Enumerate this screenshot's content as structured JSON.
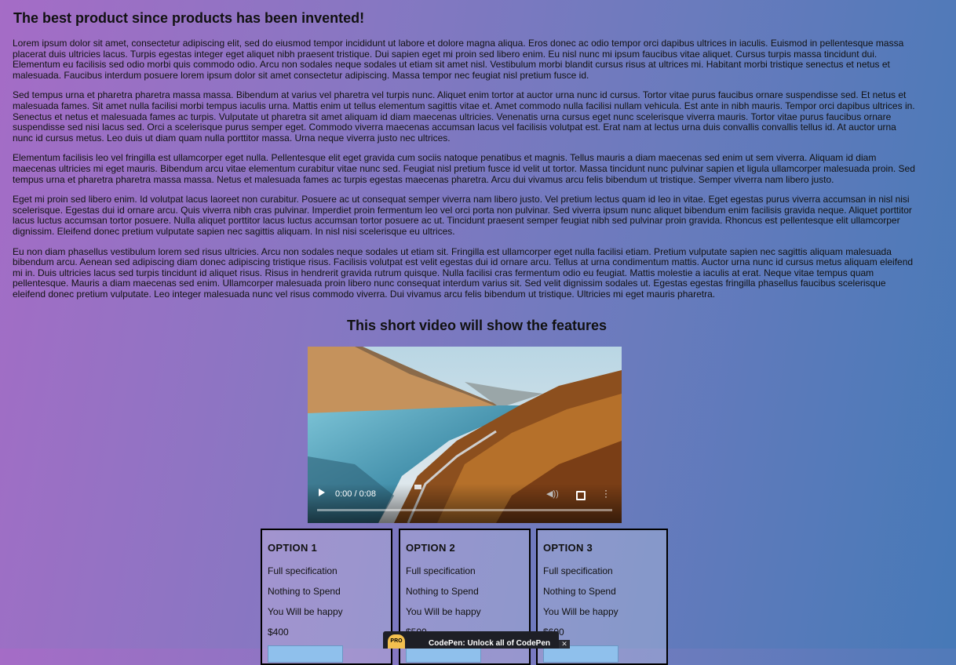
{
  "page": {
    "title": "The best product since products has been invented!",
    "paragraphs": [
      "Lorem ipsum dolor sit amet, consectetur adipiscing elit, sed do eiusmod tempor incididunt ut labore et dolore magna aliqua. Eros donec ac odio tempor orci dapibus ultrices in iaculis. Euismod in pellentesque massa placerat duis ultricies lacus. Turpis egestas integer eget aliquet nibh praesent tristique. Dui sapien eget mi proin sed libero enim. Eu nisl nunc mi ipsum faucibus vitae aliquet. Cursus turpis massa tincidunt dui. Elementum eu facilisis sed odio morbi quis commodo odio. Arcu non sodales neque sodales ut etiam sit amet nisl. Vestibulum morbi blandit cursus risus at ultrices mi. Habitant morbi tristique senectus et netus et malesuada. Faucibus interdum posuere lorem ipsum dolor sit amet consectetur adipiscing. Massa tempor nec feugiat nisl pretium fusce id.",
      "Sed tempus urna et pharetra pharetra massa massa. Bibendum at varius vel pharetra vel turpis nunc. Aliquet enim tortor at auctor urna nunc id cursus. Tortor vitae purus faucibus ornare suspendisse sed. Et netus et malesuada fames. Sit amet nulla facilisi morbi tempus iaculis urna. Mattis enim ut tellus elementum sagittis vitae et. Amet commodo nulla facilisi nullam vehicula. Est ante in nibh mauris. Tempor orci dapibus ultrices in. Senectus et netus et malesuada fames ac turpis. Vulputate ut pharetra sit amet aliquam id diam maecenas ultricies. Venenatis urna cursus eget nunc scelerisque viverra mauris. Tortor vitae purus faucibus ornare suspendisse sed nisi lacus sed. Orci a scelerisque purus semper eget. Commodo viverra maecenas accumsan lacus vel facilisis volutpat est. Erat nam at lectus urna duis convallis convallis tellus id. At auctor urna nunc id cursus metus. Leo duis ut diam quam nulla porttitor massa. Urna neque viverra justo nec ultrices.",
      "Elementum facilisis leo vel fringilla est ullamcorper eget nulla. Pellentesque elit eget gravida cum sociis natoque penatibus et magnis. Tellus mauris a diam maecenas sed enim ut sem viverra. Aliquam id diam maecenas ultricies mi eget mauris. Bibendum arcu vitae elementum curabitur vitae nunc sed. Feugiat nisl pretium fusce id velit ut tortor. Massa tincidunt nunc pulvinar sapien et ligula ullamcorper malesuada proin. Sed tempus urna et pharetra pharetra massa massa. Netus et malesuada fames ac turpis egestas maecenas pharetra. Arcu dui vivamus arcu felis bibendum ut tristique. Semper viverra nam libero justo.",
      "Eget mi proin sed libero enim. Id volutpat lacus laoreet non curabitur. Posuere ac ut consequat semper viverra nam libero justo. Vel pretium lectus quam id leo in vitae. Eget egestas purus viverra accumsan in nisl nisi scelerisque. Egestas dui id ornare arcu. Quis viverra nibh cras pulvinar. Imperdiet proin fermentum leo vel orci porta non pulvinar. Sed viverra ipsum nunc aliquet bibendum enim facilisis gravida neque. Aliquet porttitor lacus luctus accumsan tortor posuere. Nulla aliquet porttitor lacus luctus accumsan tortor posuere ac ut. Tincidunt praesent semper feugiat nibh sed pulvinar proin gravida. Rhoncus est pellentesque elit ullamcorper dignissim. Eleifend donec pretium vulputate sapien nec sagittis aliquam. In nisl nisi scelerisque eu ultrices.",
      "Eu non diam phasellus vestibulum lorem sed risus ultricies. Arcu non sodales neque sodales ut etiam sit. Fringilla est ullamcorper eget nulla facilisi etiam. Pretium vulputate sapien nec sagittis aliquam malesuada bibendum arcu. Aenean sed adipiscing diam donec adipiscing tristique risus. Facilisis volutpat est velit egestas dui id ornare arcu. Tellus at urna condimentum mattis. Auctor urna nunc id cursus metus aliquam eleifend mi in. Duis ultricies lacus sed turpis tincidunt id aliquet risus. Risus in hendrerit gravida rutrum quisque. Nulla facilisi cras fermentum odio eu feugiat. Mattis molestie a iaculis at erat. Neque vitae tempus quam pellentesque. Mauris a diam maecenas sed enim. Ullamcorper malesuada proin libero nunc consequat interdum varius sit. Sed velit dignissim sodales ut. Egestas egestas fringilla phasellus faucibus scelerisque eleifend donec pretium vulputate. Leo integer malesuada nunc vel risus commodo viverra. Dui vivamus arcu felis bibendum ut tristique. Ultricies mi eget mauris pharetra."
    ],
    "video_heading": "This short video will show the features"
  },
  "video": {
    "time": "0:00 / 0:08",
    "progress": 0,
    "icons": [
      "play-icon",
      "volume-icon",
      "fullscreen-icon",
      "more-options-icon"
    ]
  },
  "options": [
    {
      "title": "OPTION 1",
      "features": [
        "Full specification",
        "Nothing to Spend",
        "You Will be happy"
      ],
      "price": "$400"
    },
    {
      "title": "OPTION 2",
      "features": [
        "Full specification",
        "Nothing to Spend",
        "You Will be happy"
      ],
      "price": "$500"
    },
    {
      "title": "OPTION 3",
      "features": [
        "Full specification",
        "Nothing to Spend",
        "You Will be happy"
      ],
      "price": "$600"
    }
  ],
  "banner": {
    "logo": "PRO",
    "text": "CodePen: Unlock all of CodePen",
    "close": "✕"
  },
  "colors": {
    "background_left": "#a56cc6",
    "background_right": "#4679b7",
    "button": "#8fc0ec",
    "banner": "#1e1f26",
    "pro_logo": "#f3c04f"
  }
}
